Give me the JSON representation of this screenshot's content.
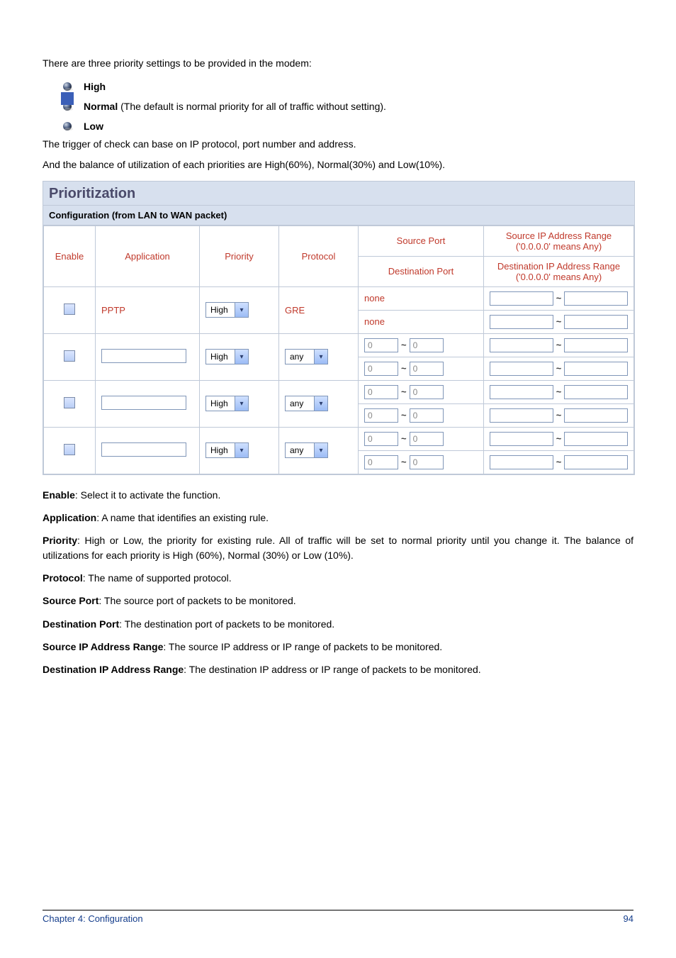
{
  "intro": {
    "line1": "There are three priority settings to be provided in the modem:",
    "bullets": [
      {
        "label": "High",
        "suffix": ""
      },
      {
        "label": "Normal",
        "suffix": "(The default is normal priority for all of traffic without setting)."
      },
      {
        "label": "Low",
        "suffix": ""
      }
    ],
    "line2": "The trigger of check can base on IP protocol, port number and address.",
    "line3": "And the balance of utilization of each priorities are High(60%), Normal(30%) and Low(10%)."
  },
  "panel": {
    "title": "Prioritization",
    "subtitle": "Configuration (from LAN to WAN packet)",
    "headers": {
      "enable": "Enable",
      "application": "Application",
      "priority": "Priority",
      "protocol": "Protocol",
      "source_port": "Source Port",
      "source_range": "Source IP Address Range ('0.0.0.0' means Any)",
      "dest_port": "Destination Port",
      "dest_range": "Destination IP Address Range ('0.0.0.0' means Any)"
    },
    "rows": [
      {
        "application": "PPTP",
        "priority": "High",
        "protocol_text": "GRE",
        "protocol_is_select": false,
        "src_port_text": "none",
        "dst_port_text": "none",
        "src_port_fields": false
      },
      {
        "application": "",
        "priority": "High",
        "protocol_text": "any",
        "protocol_is_select": true,
        "src_port_text": "",
        "dst_port_text": "",
        "src_port_fields": true
      },
      {
        "application": "",
        "priority": "High",
        "protocol_text": "any",
        "protocol_is_select": true,
        "src_port_text": "",
        "dst_port_text": "",
        "src_port_fields": true
      },
      {
        "application": "",
        "priority": "High",
        "protocol_text": "any",
        "protocol_is_select": true,
        "src_port_text": "",
        "dst_port_text": "",
        "src_port_fields": true
      }
    ],
    "field_placeholder": "0",
    "tilde": "~"
  },
  "definitions": [
    {
      "term": "Enable",
      "text": ": Select it to activate the function."
    },
    {
      "term": "Application",
      "text": ": A name that identifies an existing rule."
    },
    {
      "term": "Priority",
      "text": ": High or Low, the priority for existing rule. All of traffic will be set to normal priority until you change it. The balance of utilizations for each priority is High (60%), Normal (30%) or Low (10%)."
    },
    {
      "term": "Protocol",
      "text": ": The name of supported protocol."
    },
    {
      "term": "Source Port",
      "text": ": The source port of packets to be monitored."
    },
    {
      "term": "Destination Port",
      "text": ": The destination port of packets to be monitored."
    },
    {
      "term": "Source IP Address Range",
      "text": ": The source IP address or IP range of packets to be monitored."
    },
    {
      "term": "Destination IP Address Range",
      "text": ": The destination IP address or IP range of packets to be monitored."
    }
  ],
  "footer": {
    "left": "Chapter 4: Configuration",
    "right": "94"
  }
}
